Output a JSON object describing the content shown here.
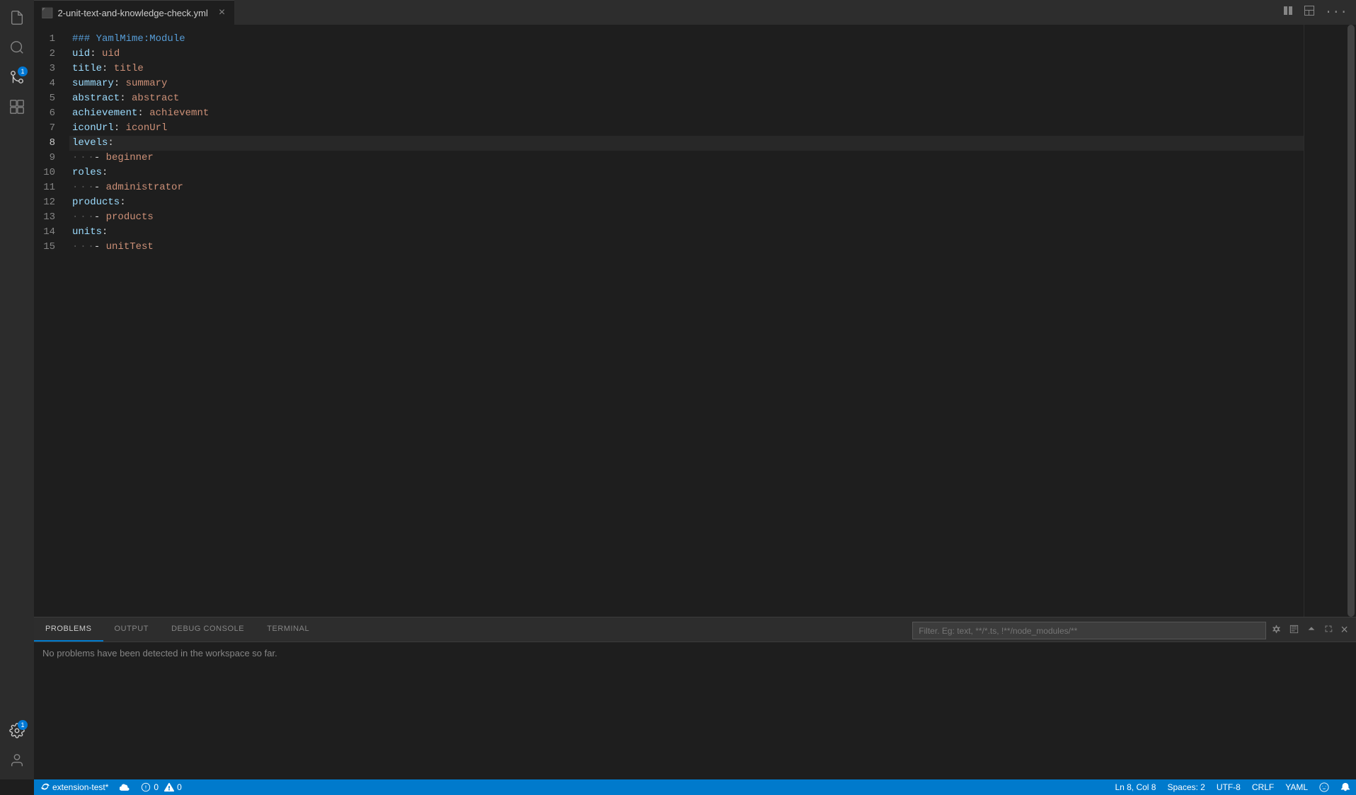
{
  "tab": {
    "icon": "📄",
    "label": "2-unit-text-and-knowledge-check.yml",
    "modified": false
  },
  "topRightIcons": [
    "split-icon",
    "layout-icon",
    "more-icon"
  ],
  "codeLines": [
    {
      "num": 1,
      "tokens": [
        {
          "type": "yaml-heading",
          "text": "### YamlMime:Module"
        }
      ]
    },
    {
      "num": 2,
      "tokens": [
        {
          "type": "yaml-key",
          "text": "uid"
        },
        {
          "type": "yaml-symbol",
          "text": ": "
        },
        {
          "type": "yaml-value",
          "text": "uid"
        }
      ]
    },
    {
      "num": 3,
      "tokens": [
        {
          "type": "yaml-key",
          "text": "title"
        },
        {
          "type": "yaml-symbol",
          "text": ": "
        },
        {
          "type": "yaml-value",
          "text": "title"
        }
      ]
    },
    {
      "num": 4,
      "tokens": [
        {
          "type": "yaml-key",
          "text": "summary"
        },
        {
          "type": "yaml-symbol",
          "text": ": "
        },
        {
          "type": "yaml-value",
          "text": "summary"
        }
      ]
    },
    {
      "num": 5,
      "tokens": [
        {
          "type": "yaml-key",
          "text": "abstract"
        },
        {
          "type": "yaml-symbol",
          "text": ": "
        },
        {
          "type": "yaml-value",
          "text": "abstract"
        }
      ]
    },
    {
      "num": 6,
      "tokens": [
        {
          "type": "yaml-key",
          "text": "achievement"
        },
        {
          "type": "yaml-symbol",
          "text": ": "
        },
        {
          "type": "yaml-value",
          "text": "achievemnt"
        }
      ]
    },
    {
      "num": 7,
      "tokens": [
        {
          "type": "yaml-key",
          "text": "iconUrl"
        },
        {
          "type": "yaml-symbol",
          "text": ": "
        },
        {
          "type": "yaml-value",
          "text": "iconUrl"
        }
      ]
    },
    {
      "num": 8,
      "tokens": [
        {
          "type": "yaml-key",
          "text": "levels"
        },
        {
          "type": "yaml-symbol",
          "text": ":"
        }
      ],
      "active": true
    },
    {
      "num": 9,
      "tokens": [
        {
          "type": "yaml-dot",
          "text": "  "
        },
        {
          "type": "yaml-dash",
          "text": "- "
        },
        {
          "type": "yaml-list-item",
          "text": "beginner"
        }
      ]
    },
    {
      "num": 10,
      "tokens": [
        {
          "type": "yaml-key",
          "text": "roles"
        },
        {
          "type": "yaml-symbol",
          "text": ":"
        }
      ]
    },
    {
      "num": 11,
      "tokens": [
        {
          "type": "yaml-dot",
          "text": "  "
        },
        {
          "type": "yaml-dash",
          "text": "- "
        },
        {
          "type": "yaml-list-item",
          "text": "administrator"
        }
      ]
    },
    {
      "num": 12,
      "tokens": [
        {
          "type": "yaml-key",
          "text": "products"
        },
        {
          "type": "yaml-symbol",
          "text": ":"
        }
      ]
    },
    {
      "num": 13,
      "tokens": [
        {
          "type": "yaml-dot",
          "text": "  "
        },
        {
          "type": "yaml-dash",
          "text": "- "
        },
        {
          "type": "yaml-list-item",
          "text": "products"
        }
      ]
    },
    {
      "num": 14,
      "tokens": [
        {
          "type": "yaml-key",
          "text": "units"
        },
        {
          "type": "yaml-symbol",
          "text": ":"
        }
      ]
    },
    {
      "num": 15,
      "tokens": [
        {
          "type": "yaml-dot",
          "text": "  "
        },
        {
          "type": "yaml-dash",
          "text": "- "
        },
        {
          "type": "yaml-list-item",
          "text": "unitTest"
        }
      ]
    }
  ],
  "panel": {
    "tabs": [
      "PROBLEMS",
      "OUTPUT",
      "DEBUG CONSOLE",
      "TERMINAL"
    ],
    "activeTab": "PROBLEMS",
    "filterPlaceholder": "Filter. Eg: text, **/*.ts, !**/node_modules/**",
    "noProblemsText": "No problems have been detected in the workspace so far."
  },
  "statusBar": {
    "left": {
      "syncIcon": "↻",
      "projectName": "extension-test*",
      "cloudIcon": "☁",
      "errorsIcon": "✕",
      "errorsCount": "0",
      "warningsIcon": "△",
      "warningsCount": "0"
    },
    "right": {
      "position": "Ln 8, Col 8",
      "spaces": "Spaces: 2",
      "encoding": "UTF-8",
      "lineEnding": "CRLF",
      "language": "YAML",
      "feedbackIcon": "😊"
    }
  },
  "activityBar": {
    "icons": [
      {
        "name": "files-icon",
        "symbol": "⬜",
        "active": false
      },
      {
        "name": "search-icon",
        "symbol": "🔍",
        "active": false
      },
      {
        "name": "source-control-icon",
        "symbol": "⎇",
        "active": true,
        "badge": "1"
      },
      {
        "name": "extensions-icon",
        "symbol": "⧉",
        "active": false
      }
    ],
    "bottomIcons": [
      {
        "name": "settings-icon",
        "symbol": "⚙",
        "badge": "1"
      },
      {
        "name": "account-icon",
        "symbol": "👤"
      }
    ]
  }
}
